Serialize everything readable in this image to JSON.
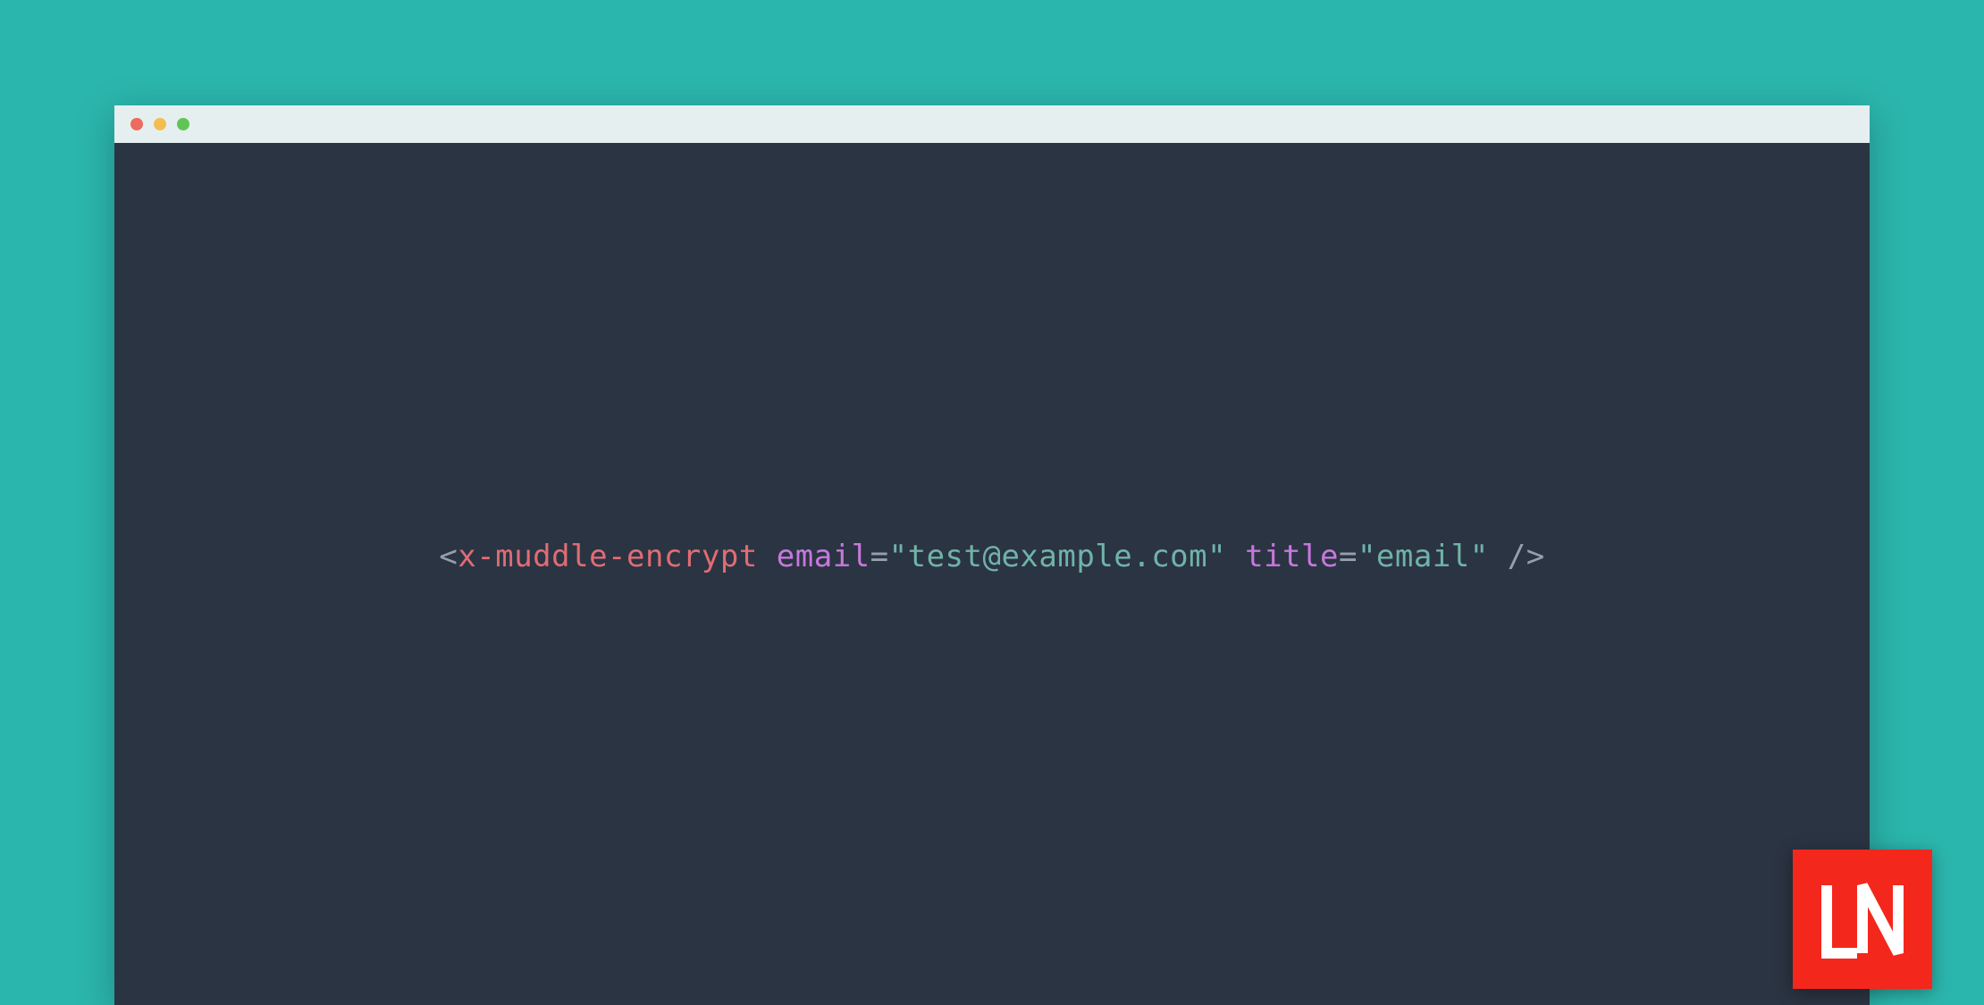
{
  "window": {
    "traffic_lights": [
      "red",
      "yellow",
      "green"
    ]
  },
  "code": {
    "open_bracket": "<",
    "tag": "x-muddle-encrypt",
    "attr1_name": "email",
    "attr1_value": "\"test@example.com\"",
    "attr2_name": "title",
    "attr2_value": "\"email\"",
    "eq": "=",
    "space": " ",
    "self_close": "/>"
  },
  "logo": {
    "letters": "LN"
  }
}
